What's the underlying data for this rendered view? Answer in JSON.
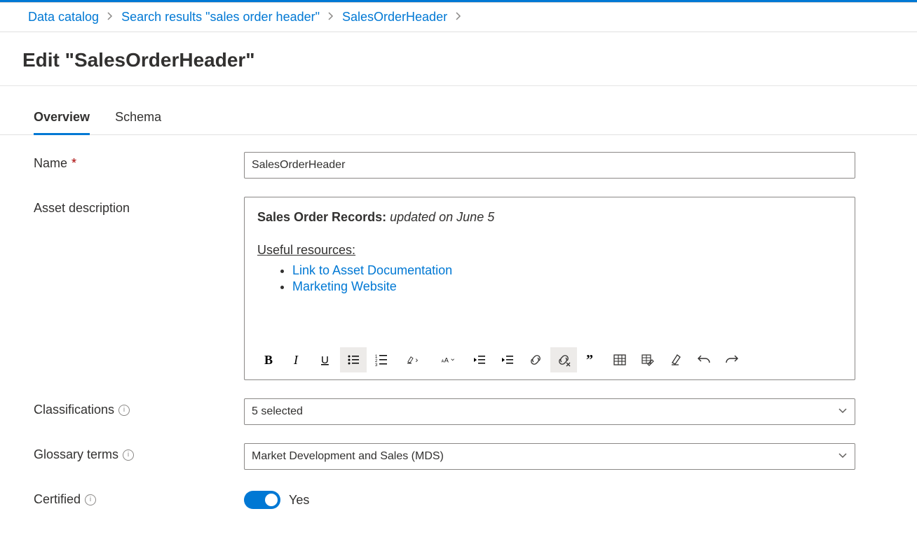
{
  "breadcrumb": {
    "items": [
      {
        "label": "Data catalog"
      },
      {
        "label": "Search results \"sales order header\""
      },
      {
        "label": "SalesOrderHeader"
      }
    ]
  },
  "page": {
    "title": "Edit \"SalesOrderHeader\""
  },
  "tabs": {
    "overview": "Overview",
    "schema": "Schema"
  },
  "form": {
    "name": {
      "label": "Name",
      "value": "SalesOrderHeader"
    },
    "description": {
      "label": "Asset description",
      "content": {
        "heading_bold": "Sales Order Records:",
        "heading_italic": " updated on June 5",
        "subheading": "Useful resources:",
        "links": [
          "Link to Asset Documentation",
          "Marketing Website"
        ]
      }
    },
    "classifications": {
      "label": "Classifications",
      "value": "5 selected"
    },
    "glossary": {
      "label": "Glossary terms",
      "value": "Market Development and Sales (MDS)"
    },
    "certified": {
      "label": "Certified",
      "value": "Yes"
    }
  },
  "toolbar": {
    "bold": "Bold",
    "italic": "Italic",
    "underline": "Underline",
    "bullets": "Bulleted list",
    "numbers": "Numbered list",
    "highlight": "Highlight",
    "fontsize": "Font size",
    "outdent": "Decrease indent",
    "indent": "Increase indent",
    "link": "Link",
    "unlink": "Remove link",
    "quote": "Quote",
    "table": "Insert table",
    "edit_table": "Edit table",
    "clear": "Clear formatting",
    "undo": "Undo",
    "redo": "Redo"
  }
}
